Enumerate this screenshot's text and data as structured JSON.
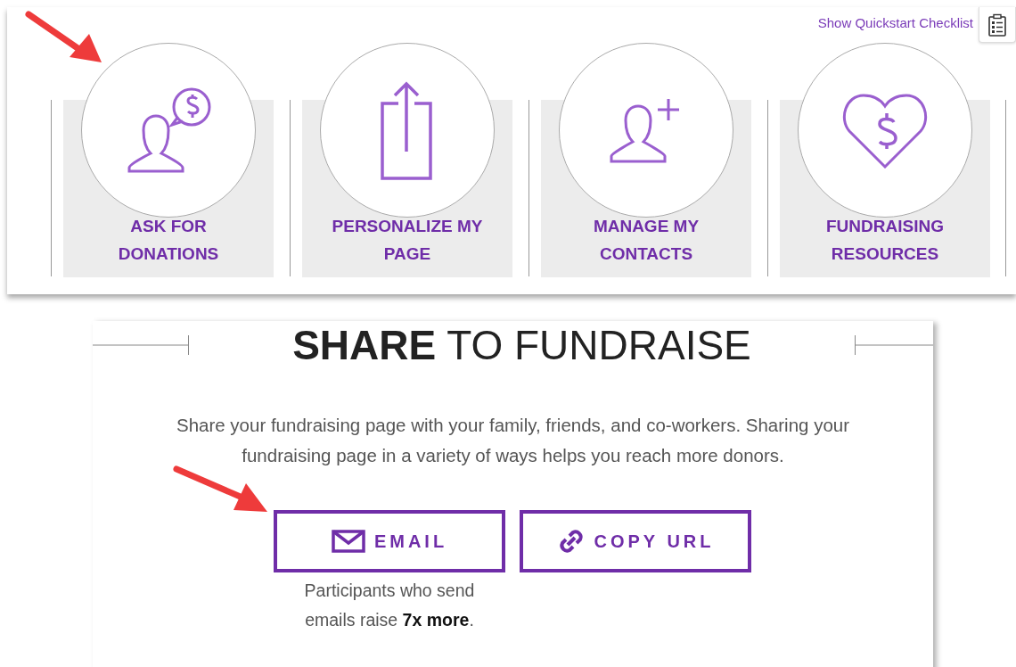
{
  "quickstart": {
    "link": "Show Quickstart Checklist"
  },
  "tiles": [
    {
      "label": "ASK FOR DONATIONS"
    },
    {
      "label": "PERSONALIZE MY PAGE"
    },
    {
      "label": "MANAGE MY CONTACTS"
    },
    {
      "label": "FUNDRAISING RESOURCES"
    }
  ],
  "share": {
    "title": "**SHARE** TO FUNDRAISE",
    "description": "Share your fundraising page with your family, friends, and co-workers. Sharing your fundraising page in a variety of ways helps you reach more donors.",
    "buttons": [
      {
        "kind": "email",
        "label": "EMAIL",
        "note": "Participants who send emails raise **7x more**."
      },
      {
        "kind": "link",
        "label": "COPY URL"
      }
    ]
  }
}
